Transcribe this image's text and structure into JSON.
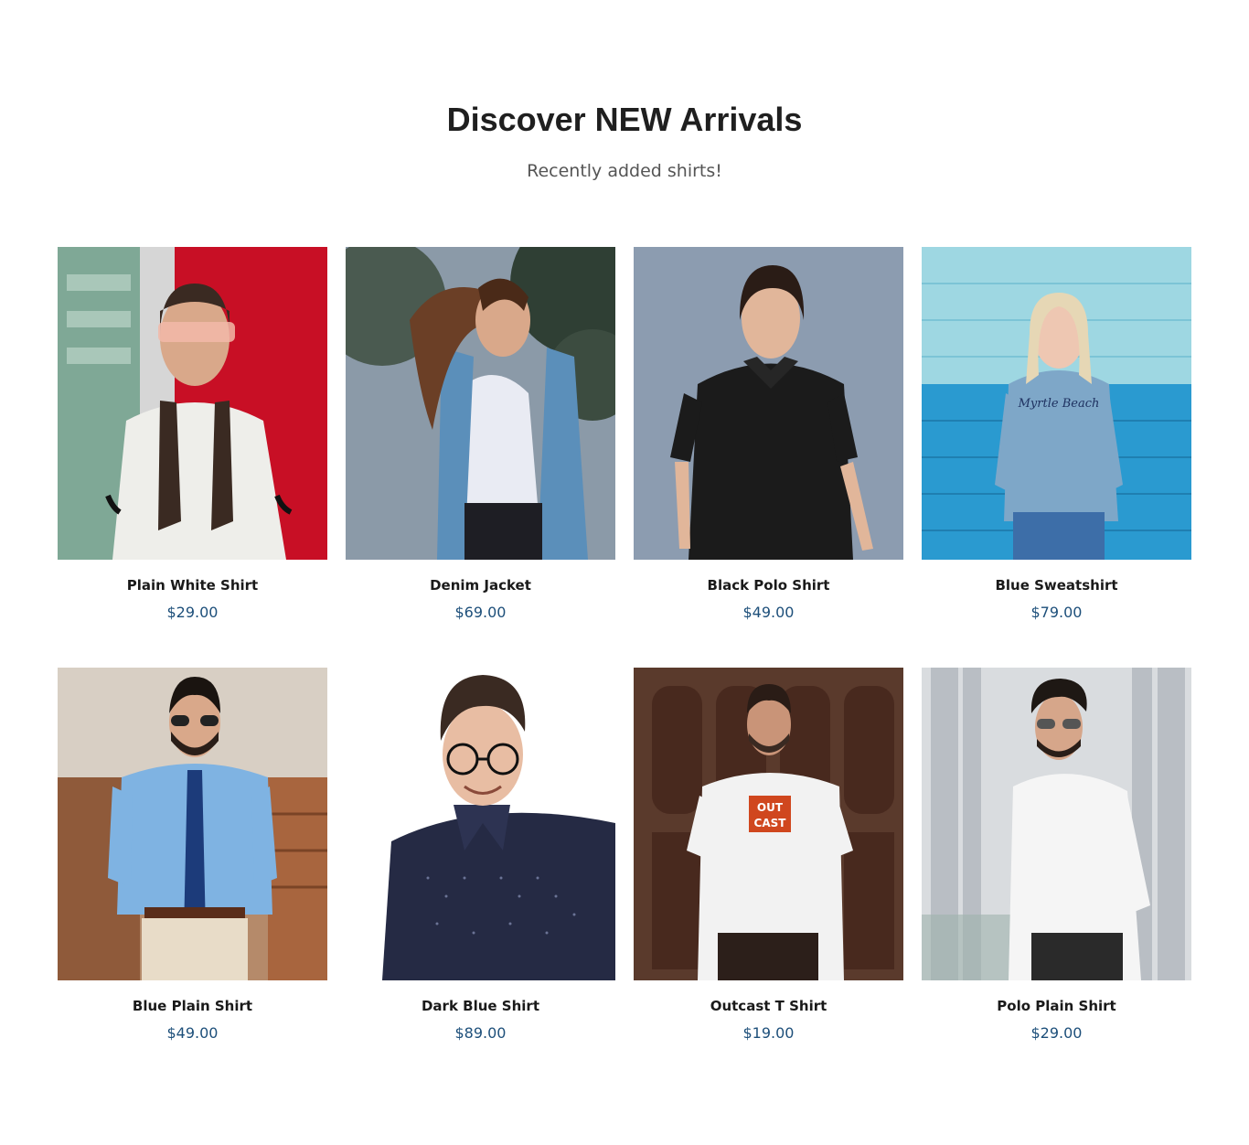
{
  "section": {
    "title": "Discover NEW Arrivals",
    "subtitle": "Recently added shirts!"
  },
  "colors": {
    "title": "#1f1f1f",
    "subtitle": "#555555",
    "price": "#1d4f7a"
  },
  "products": [
    {
      "name": "Plain White Shirt",
      "price": "$29.00",
      "image": "woman-white-tee-photo"
    },
    {
      "name": "Denim Jacket",
      "price": "$69.00",
      "image": "woman-denim-jacket-photo"
    },
    {
      "name": "Black Polo Shirt",
      "price": "$49.00",
      "image": "woman-black-polo-photo"
    },
    {
      "name": "Blue Sweatshirt",
      "price": "$79.00",
      "image": "woman-blue-sweatshirt-photo"
    },
    {
      "name": "Blue Plain Shirt",
      "price": "$49.00",
      "image": "man-blue-shirt-tie-photo"
    },
    {
      "name": "Dark Blue Shirt",
      "price": "$89.00",
      "image": "man-dark-blue-shirt-photo"
    },
    {
      "name": "Outcast T Shirt",
      "price": "$19.00",
      "image": "man-outcast-tee-photo"
    },
    {
      "name": "Polo Plain Shirt",
      "price": "$29.00",
      "image": "man-white-shirt-photo"
    }
  ]
}
